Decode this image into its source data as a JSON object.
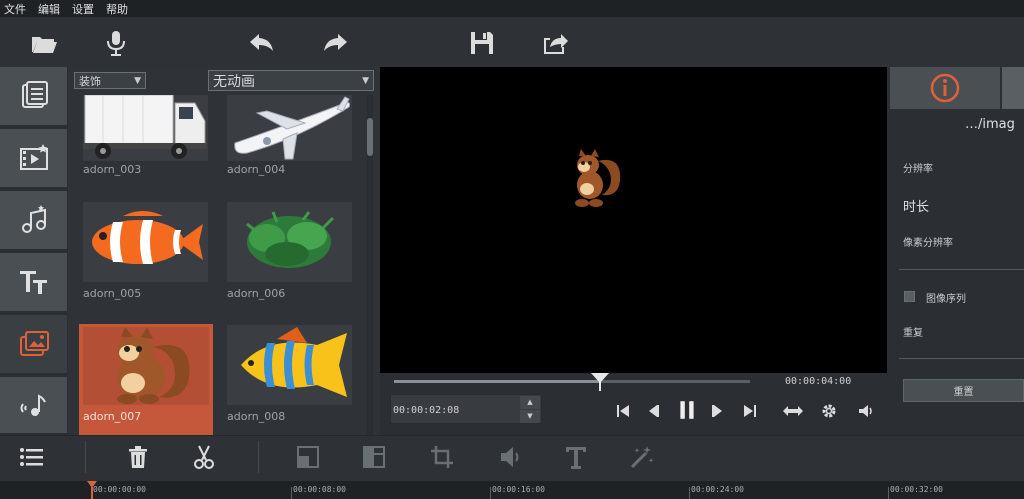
{
  "menu": [
    "文件",
    "编辑",
    "设置",
    "帮助"
  ],
  "toolbar": {
    "icons": [
      "open-folder-icon",
      "microphone-icon",
      "undo-icon",
      "redo-icon",
      "save-icon",
      "export-icon"
    ]
  },
  "nav": {
    "icons": [
      "media-icon",
      "video-effects-icon",
      "music-icon",
      "text-icon",
      "overlay-icon",
      "sound-effects-icon"
    ]
  },
  "library": {
    "category": "装饰",
    "animation": "无动画",
    "items": [
      {
        "label": "adorn_003"
      },
      {
        "label": "adorn_004"
      },
      {
        "label": "adorn_005"
      },
      {
        "label": "adorn_006"
      },
      {
        "label": "adorn_007"
      },
      {
        "label": "adorn_008"
      }
    ],
    "selected": "adorn_007"
  },
  "player": {
    "total_time": "00:00:04:00",
    "current_time": "00:00:02:08",
    "progress": 0.58
  },
  "properties": {
    "path": "…/imag",
    "resolution_label": "分辨率",
    "duration_label": "时长",
    "pixel_resolution_label": "像素分辨率",
    "image_sequence_label": "图像序列",
    "repeat_label": "重复",
    "reset_label": "重置"
  },
  "timeline": {
    "ticks": [
      "00:00:00:00",
      "00:00:08:00",
      "00:00:16:00",
      "00:00:24:00",
      "00:00:32:00"
    ]
  },
  "colors": {
    "accent": "#e0603a",
    "selected_tile": "#c5583b"
  }
}
